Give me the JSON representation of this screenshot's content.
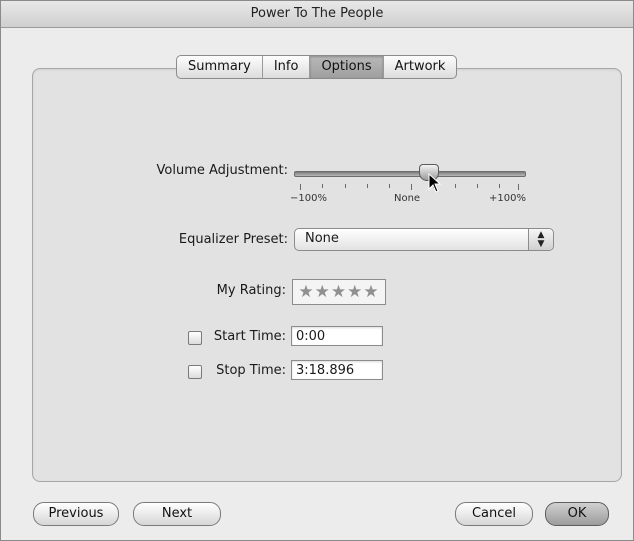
{
  "window": {
    "title": "Power To The People"
  },
  "tabs": [
    {
      "label": "Summary",
      "selected": false
    },
    {
      "label": "Info",
      "selected": false
    },
    {
      "label": "Options",
      "selected": true
    },
    {
      "label": "Artwork",
      "selected": false
    }
  ],
  "volume": {
    "label": "Volume Adjustment:",
    "value_percent": 25,
    "min_label": "−100%",
    "mid_label": "None",
    "max_label": "+100%"
  },
  "equalizer": {
    "label": "Equalizer Preset:",
    "selected": "None",
    "arrows": "▲▼"
  },
  "rating": {
    "label": "My Rating:",
    "stars": "★★★★★"
  },
  "start_time": {
    "label": "Start Time:",
    "checked": false,
    "value": "0:00"
  },
  "stop_time": {
    "label": "Stop Time:",
    "checked": false,
    "value": "3:18.896"
  },
  "buttons": {
    "previous": "Previous",
    "next": "Next",
    "cancel": "Cancel",
    "ok": "OK"
  }
}
